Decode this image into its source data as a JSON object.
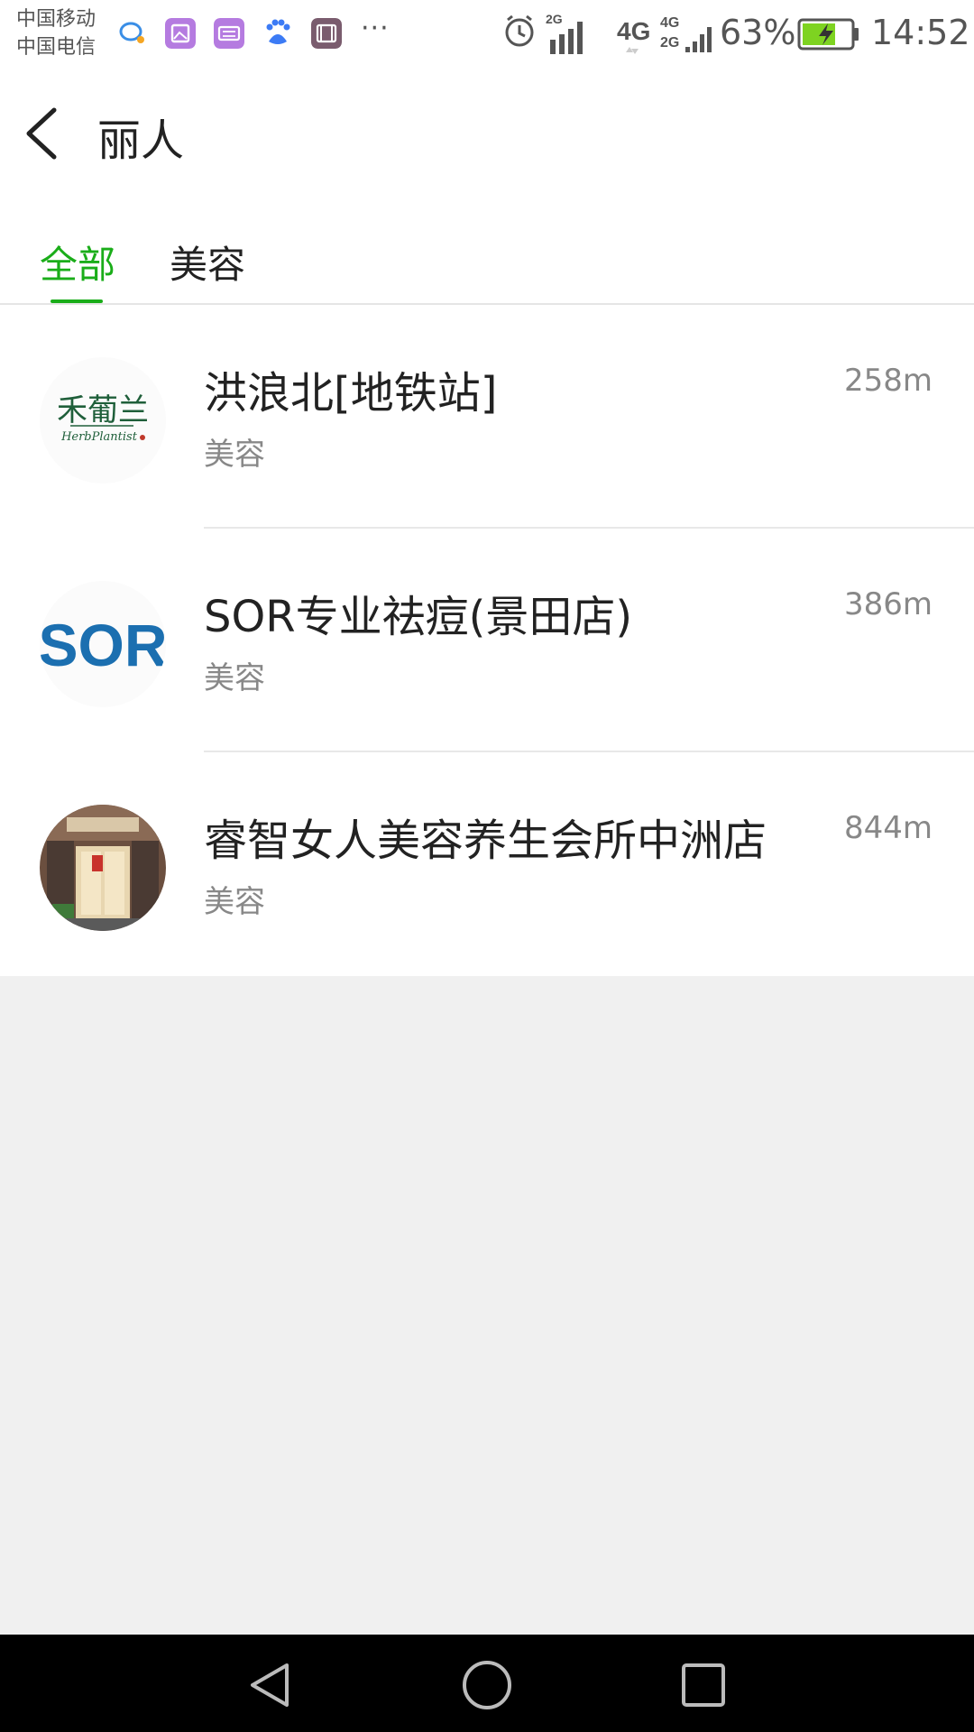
{
  "status_bar": {
    "carrier_1": "中国移动",
    "carrier_2": "中国电信",
    "more": "···",
    "net_label_2g": "2G",
    "net_label_4g": "4G",
    "net_label_4g2": "4G",
    "net_label_2g2": "2G",
    "battery": "63%",
    "time": "14:52",
    "notif_icons": [
      "chat-icon",
      "gallery-icon",
      "keyboard-icon",
      "baidu-icon",
      "video-icon"
    ]
  },
  "header": {
    "title": "丽人"
  },
  "tabs": [
    {
      "label": "全部",
      "active": true
    },
    {
      "label": "美容",
      "active": false
    }
  ],
  "stores": [
    {
      "name": "洪浪北[地铁站]",
      "category": "美容",
      "distance": "258m",
      "logo": "herbplantist-logo",
      "logo_text": "禾葡兰",
      "logo_subtext": "HerbPlantist"
    },
    {
      "name": "SOR专业祛痘(景田店)",
      "category": "美容",
      "distance": "386m",
      "logo": "sor-logo",
      "logo_text": "SOR"
    },
    {
      "name": "睿智女人美容养生会所中洲店",
      "category": "美容",
      "distance": "844m",
      "logo": "storefront-photo"
    }
  ],
  "colors": {
    "accent": "#1aad19",
    "text_primary": "#222222",
    "text_secondary": "#888888",
    "background": "#f0f0f0"
  }
}
